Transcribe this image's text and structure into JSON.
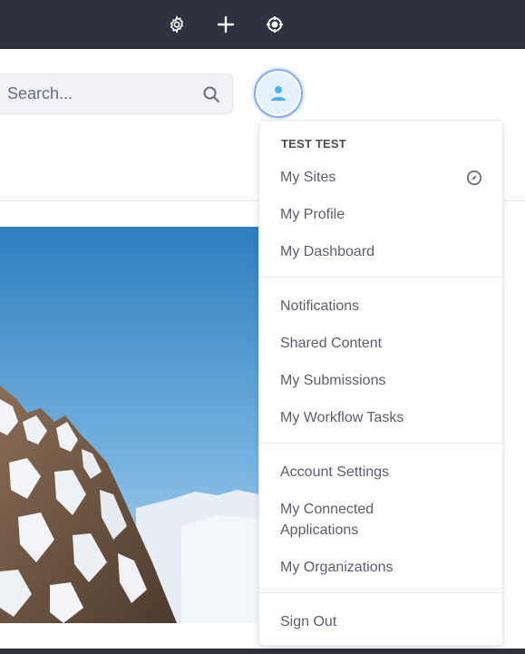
{
  "topbar": {
    "icons": [
      "gear-icon",
      "plus-icon",
      "simulation-icon"
    ],
    "background": "#30313f"
  },
  "search": {
    "placeholder": "Search...",
    "icon": "search-icon"
  },
  "user_menu": {
    "avatar_icon": "user-icon",
    "user_name": "TEST TEST",
    "groups": [
      {
        "items": [
          {
            "label": "My Sites",
            "icon": "compass-icon"
          },
          {
            "label": "My Profile"
          },
          {
            "label": "My Dashboard"
          }
        ]
      },
      {
        "items": [
          {
            "label": "Notifications"
          },
          {
            "label": "Shared Content"
          },
          {
            "label": "My Submissions"
          },
          {
            "label": "My Workflow Tasks"
          }
        ]
      },
      {
        "items": [
          {
            "label": "Account Settings"
          },
          {
            "label": "My Connected Applications"
          },
          {
            "label": "My Organizations"
          }
        ]
      },
      {
        "items": [
          {
            "label": "Sign Out"
          }
        ]
      }
    ]
  },
  "colors": {
    "accent": "#80acff",
    "avatar_bg": "#e6f1ff",
    "avatar_icon": "#4fb0f7"
  }
}
